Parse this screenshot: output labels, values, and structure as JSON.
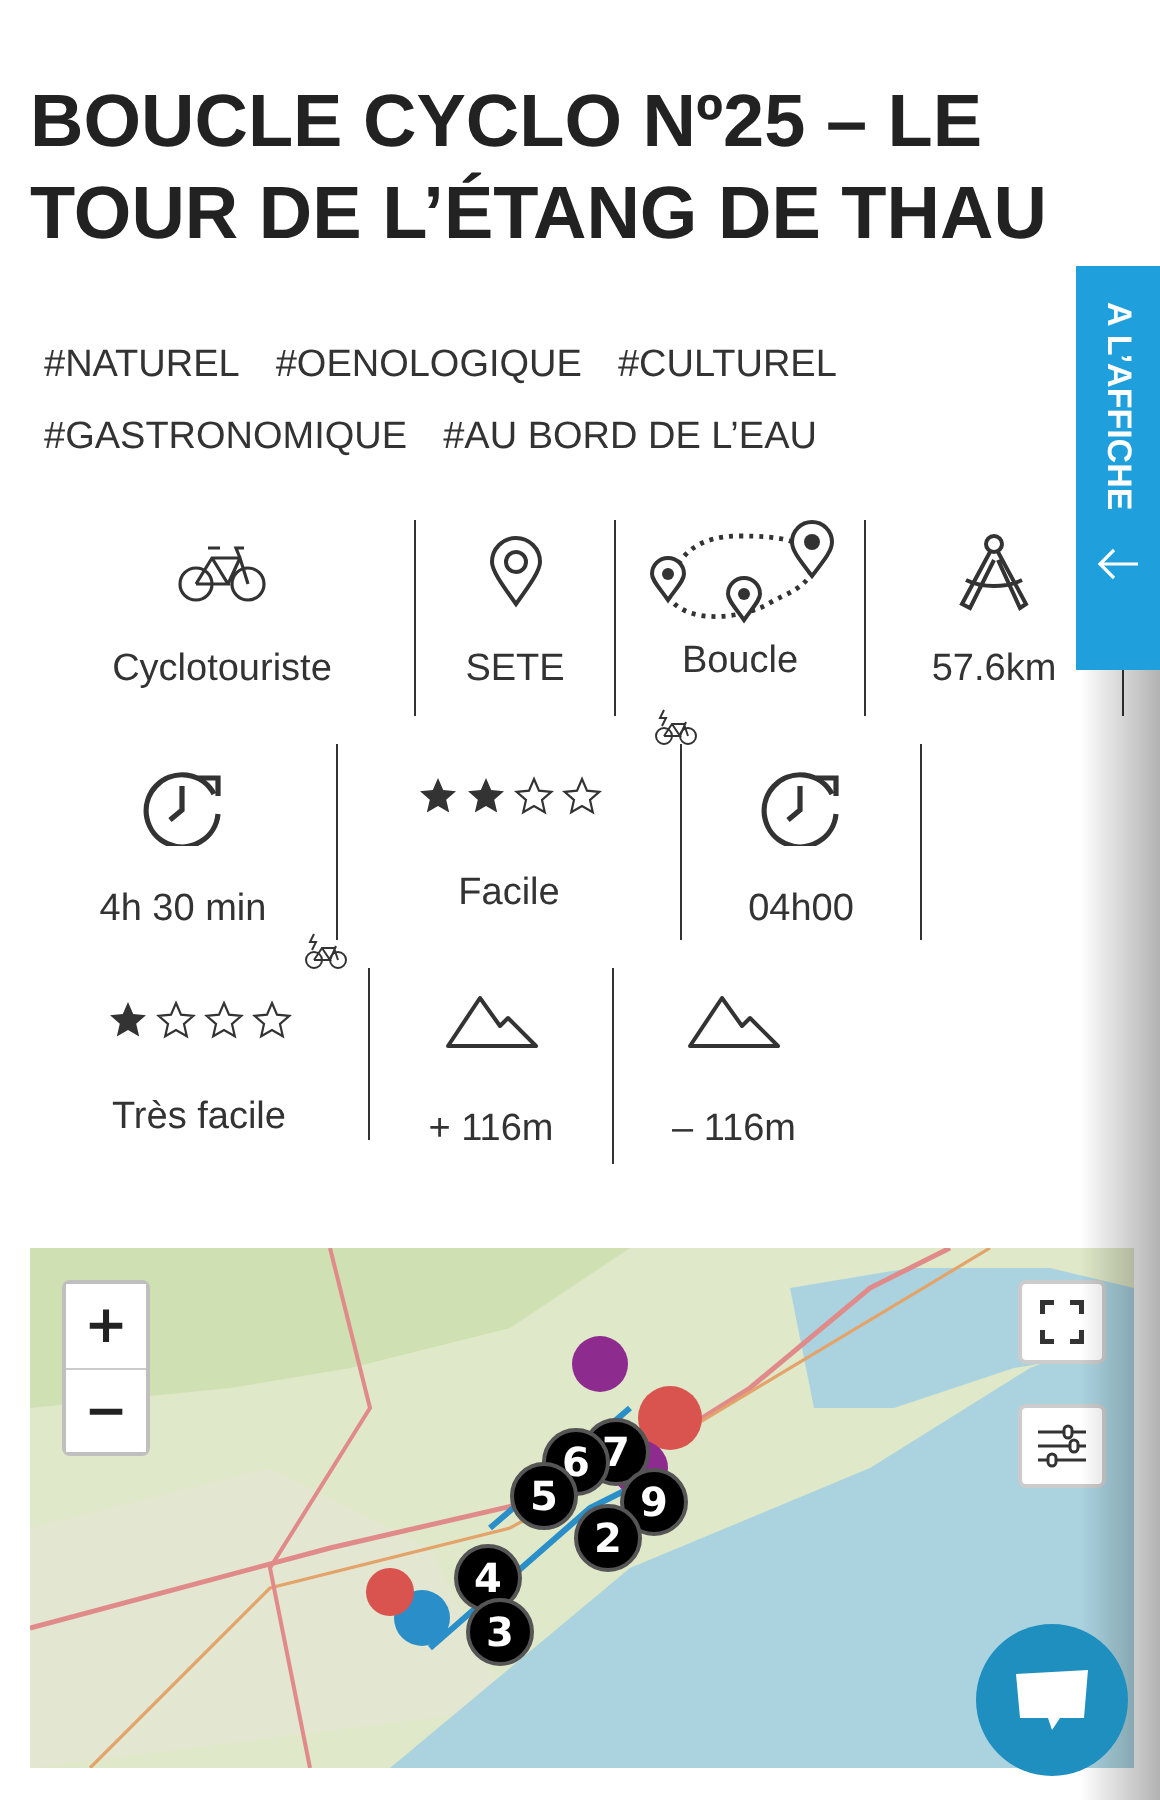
{
  "title": "BOUCLE CYCLO Nº25 – LE TOUR DE L’ÉTANG DE THAU",
  "tags": [
    "#NATUREL",
    "#OENOLOGIQUE",
    "#CULTUREL",
    "#GASTRONOMIQUE",
    "#AU BORD DE L’EAU"
  ],
  "side_tab": {
    "label": "A L’AFFICHE"
  },
  "info_rows": [
    [
      {
        "kind": "bike",
        "text": "Cyclotouriste"
      },
      {
        "kind": "pin",
        "text": "SETE"
      },
      {
        "kind": "route",
        "text": "Boucle"
      },
      {
        "kind": "compass",
        "text": "57.6km"
      }
    ],
    [
      {
        "kind": "clock",
        "text": "4h 30 min"
      },
      {
        "kind": "stars",
        "stars": 2,
        "text": "Facile"
      },
      {
        "kind": "clock",
        "text": "04h00",
        "ebike": true
      }
    ],
    [
      {
        "kind": "stars",
        "stars": 1,
        "text": "Très facile",
        "ebike": true
      },
      {
        "kind": "mountain",
        "text": "+ 116m"
      },
      {
        "kind": "mountain",
        "text": "– 116m"
      }
    ]
  ],
  "map": {
    "zoom_in": "+",
    "zoom_out": "−",
    "markers": [
      {
        "label": "7"
      },
      {
        "label": "6"
      },
      {
        "label": "5"
      },
      {
        "label": "9"
      },
      {
        "label": "2"
      },
      {
        "label": "4"
      },
      {
        "label": "3"
      }
    ]
  }
}
